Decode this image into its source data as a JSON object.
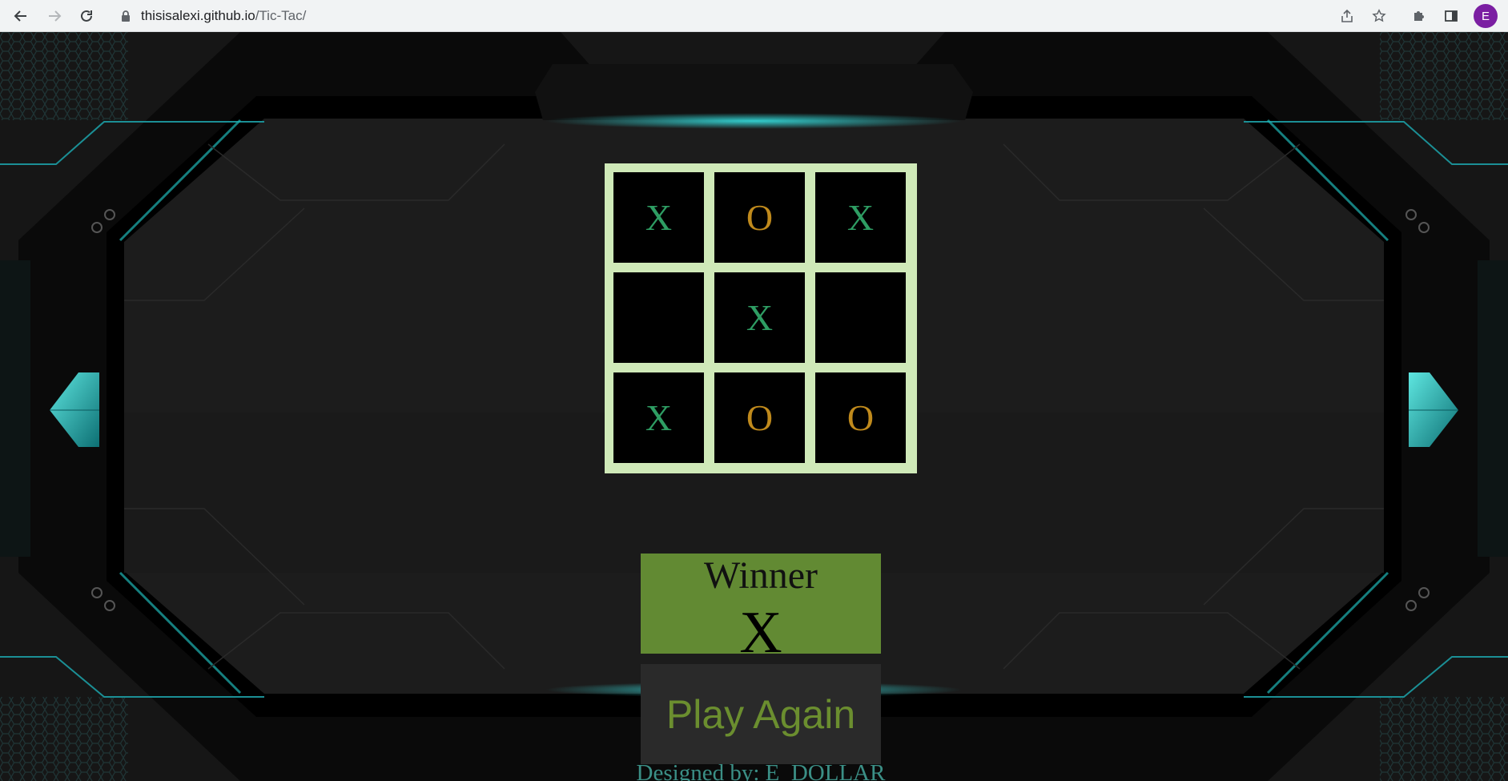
{
  "browser": {
    "url_host": "thisisalexi.github.io",
    "url_path": "/Tic-Tac/",
    "profile_initial": "E"
  },
  "game": {
    "board": [
      [
        "X",
        "O",
        "X"
      ],
      [
        "",
        "X",
        ""
      ],
      [
        "X",
        "O",
        "O"
      ]
    ],
    "winner_label": "Winner",
    "winner_value": "X",
    "play_again_label": "Play Again",
    "credit": "Designed by: E_DOLLAR"
  },
  "colors": {
    "x_mark": "#2e9d63",
    "o_mark": "#c08a1c",
    "board_frame": "#cfe9b8",
    "winner_bg": "#628a33",
    "play_again_text": "#6b8e2f",
    "accent_teal": "#1fb5b5"
  },
  "icons": {
    "back": "arrow-left-icon",
    "forward": "arrow-right-icon",
    "reload": "reload-icon",
    "lock": "lock-icon",
    "share": "share-icon",
    "bookmark": "star-icon",
    "extensions": "puzzle-icon",
    "side_panel": "side-panel-icon"
  }
}
